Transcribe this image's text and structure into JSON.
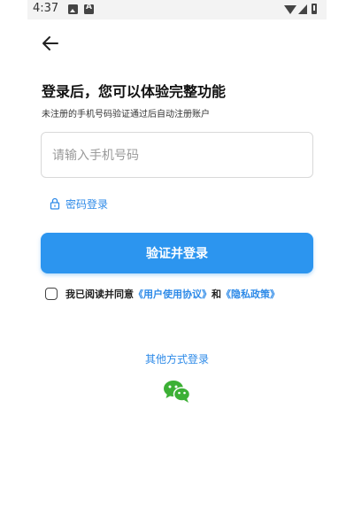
{
  "status_bar": {
    "time": "4:37",
    "icons": [
      "gallery-icon",
      "a-icon",
      "wifi-icon",
      "cellular-icon",
      "battery-icon"
    ]
  },
  "nav": {
    "back_icon": "arrow-left-icon"
  },
  "header": {
    "title": "登录后，您可以体验完整功能",
    "subtitle": "未注册的手机号码验证通过后自动注册账户"
  },
  "form": {
    "phone_placeholder": "请输入手机号码",
    "phone_value": "",
    "password_login_label": "密码登录",
    "password_login_icon": "lock-icon",
    "submit_label": "验证并登录"
  },
  "agreement": {
    "prefix": "我已阅读并同意",
    "user_agreement": "《用户使用协议》",
    "conjunction": "和",
    "privacy_policy": "《隐私政策》"
  },
  "other_login": {
    "label": "其他方式登录",
    "icons": [
      "wechat-icon"
    ]
  },
  "colors": {
    "accent": "#2c95ef",
    "link": "#2d8ae8",
    "wechat_green": "#3cb035"
  }
}
